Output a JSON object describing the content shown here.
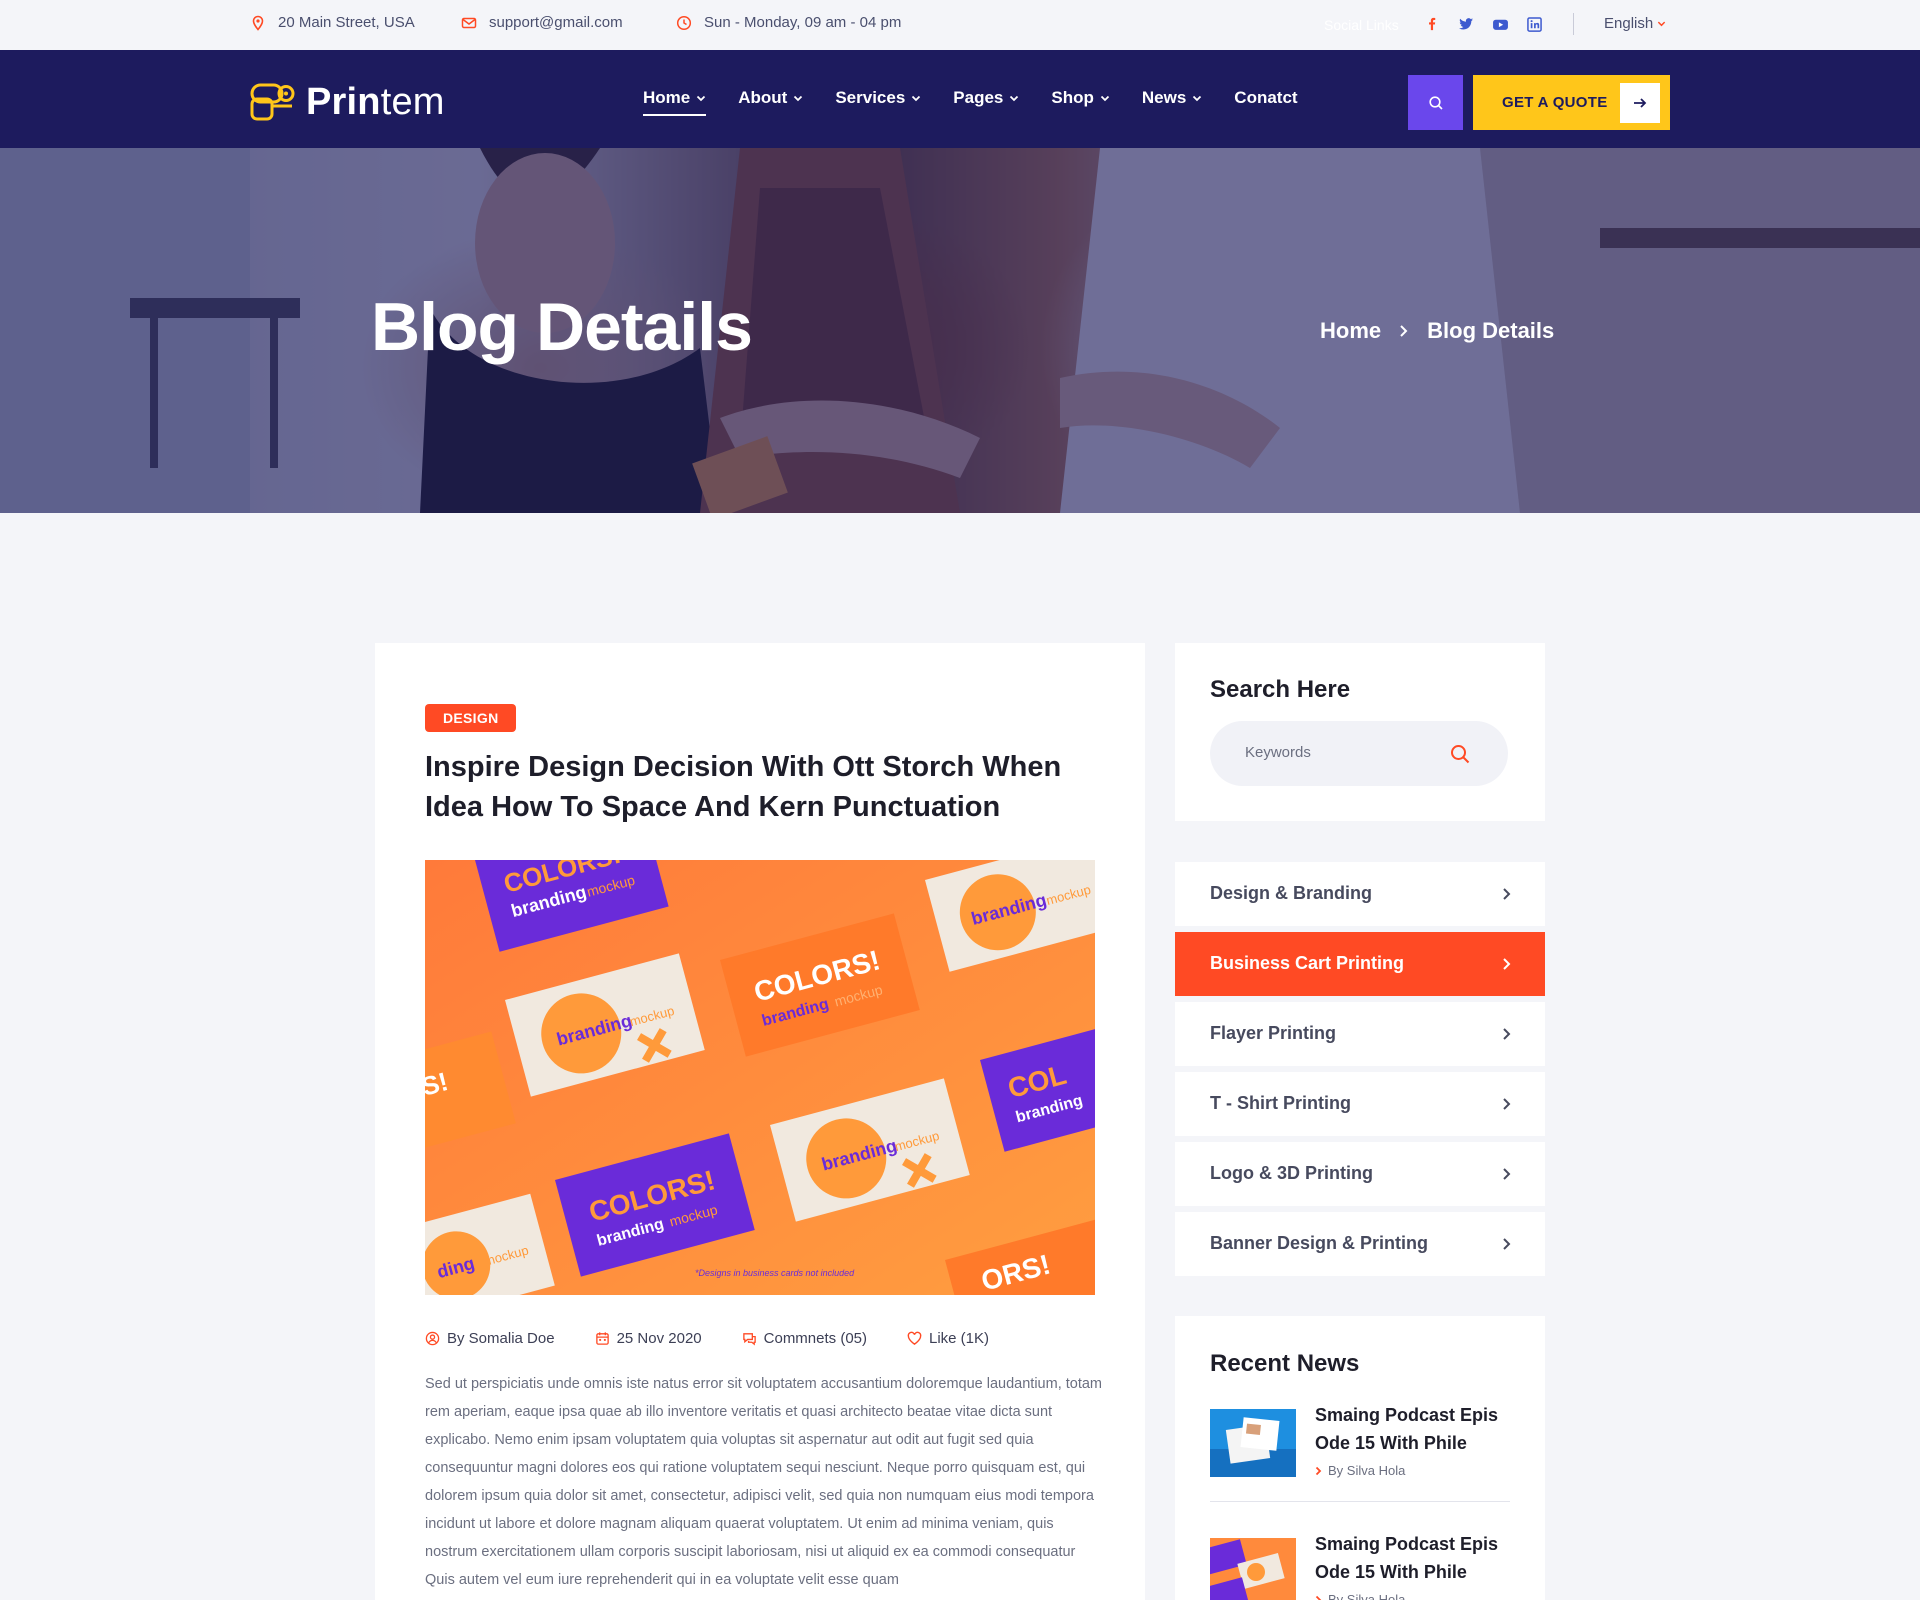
{
  "topbar": {
    "address": "20 Main Street, USA",
    "email": "support@gmail.com",
    "hours": "Sun - Monday, 09 am - 04 pm",
    "social_label": "Social Links",
    "social_icons": [
      "facebook-icon",
      "twitter-icon",
      "youtube-icon",
      "linkedin-icon"
    ],
    "language": "English"
  },
  "nav": {
    "logo_bold": "Prin",
    "logo_rest": "tem",
    "items": [
      {
        "label": "Home",
        "active": true
      },
      {
        "label": "About"
      },
      {
        "label": "Services"
      },
      {
        "label": "Pages"
      },
      {
        "label": "Shop"
      },
      {
        "label": "News"
      },
      {
        "label": "Conatct"
      }
    ],
    "quote_label": "GET A QUOTE"
  },
  "hero": {
    "title": "Blog Details",
    "breadcrumb_home": "Home",
    "breadcrumb_current": "Blog Details"
  },
  "post": {
    "tag": "DESIGN",
    "title": "Inspire Design Decision With Ott Storch When Idea How To Space And Kern Punctuation",
    "author": "By Somalia Doe",
    "date": "25 Nov 2020",
    "comments": "Commnets (05)",
    "likes": "Like (1K)",
    "body": "Sed ut perspiciatis unde omnis iste natus error sit voluptatem accusantium doloremque laudantium, totam rem aperiam, eaque ipsa quae ab illo inventore veritatis et quasi architecto beatae vitae dicta sunt explicabo. Nemo enim ipsam voluptatem quia voluptas sit aspernatur aut odit aut fugit sed quia consequuntur magni dolores eos qui ratione voluptatem sequi nesciunt. Neque porro quisquam est, qui dolorem ipsum quia dolor sit amet, consectetur, adipisci velit, sed quia non numquam eius modi tempora incidunt ut labore et dolore magnam aliquam quaerat voluptatem. Ut enim ad minima veniam, quis nostrum exercitationem ullam corporis suscipit laboriosam, nisi ut aliquid ex ea commodi consequatur Quis autem vel eum iure reprehenderit qui in ea voluptate velit esse quam",
    "image_text": {
      "colors": "COLORS!",
      "branding": "branding",
      "mockup": "mockup",
      "note": "*Designs in business cards not included"
    }
  },
  "sidebar": {
    "search_title": "Search Here",
    "search_placeholder": "Keywords",
    "categories": [
      {
        "label": "Design  & Branding"
      },
      {
        "label": "Business Cart Printing",
        "active": true
      },
      {
        "label": "Flayer Printing"
      },
      {
        "label": "T - Shirt Printing"
      },
      {
        "label": "Logo & 3D Printing"
      },
      {
        "label": "Banner Design & Printing"
      }
    ],
    "recent_title": "Recent News",
    "recent": [
      {
        "title": "Smaing Podcast Epis Ode 15 With Phile",
        "author": "By Silva Hola"
      },
      {
        "title": "Smaing Podcast Epis Ode 15 With Phile",
        "author": "By Silva Hola"
      }
    ]
  },
  "colors": {
    "navy": "#1d1b5e",
    "accent_red": "#ff4a24",
    "purple": "#6a47ec",
    "yellow": "#ffc61a"
  }
}
